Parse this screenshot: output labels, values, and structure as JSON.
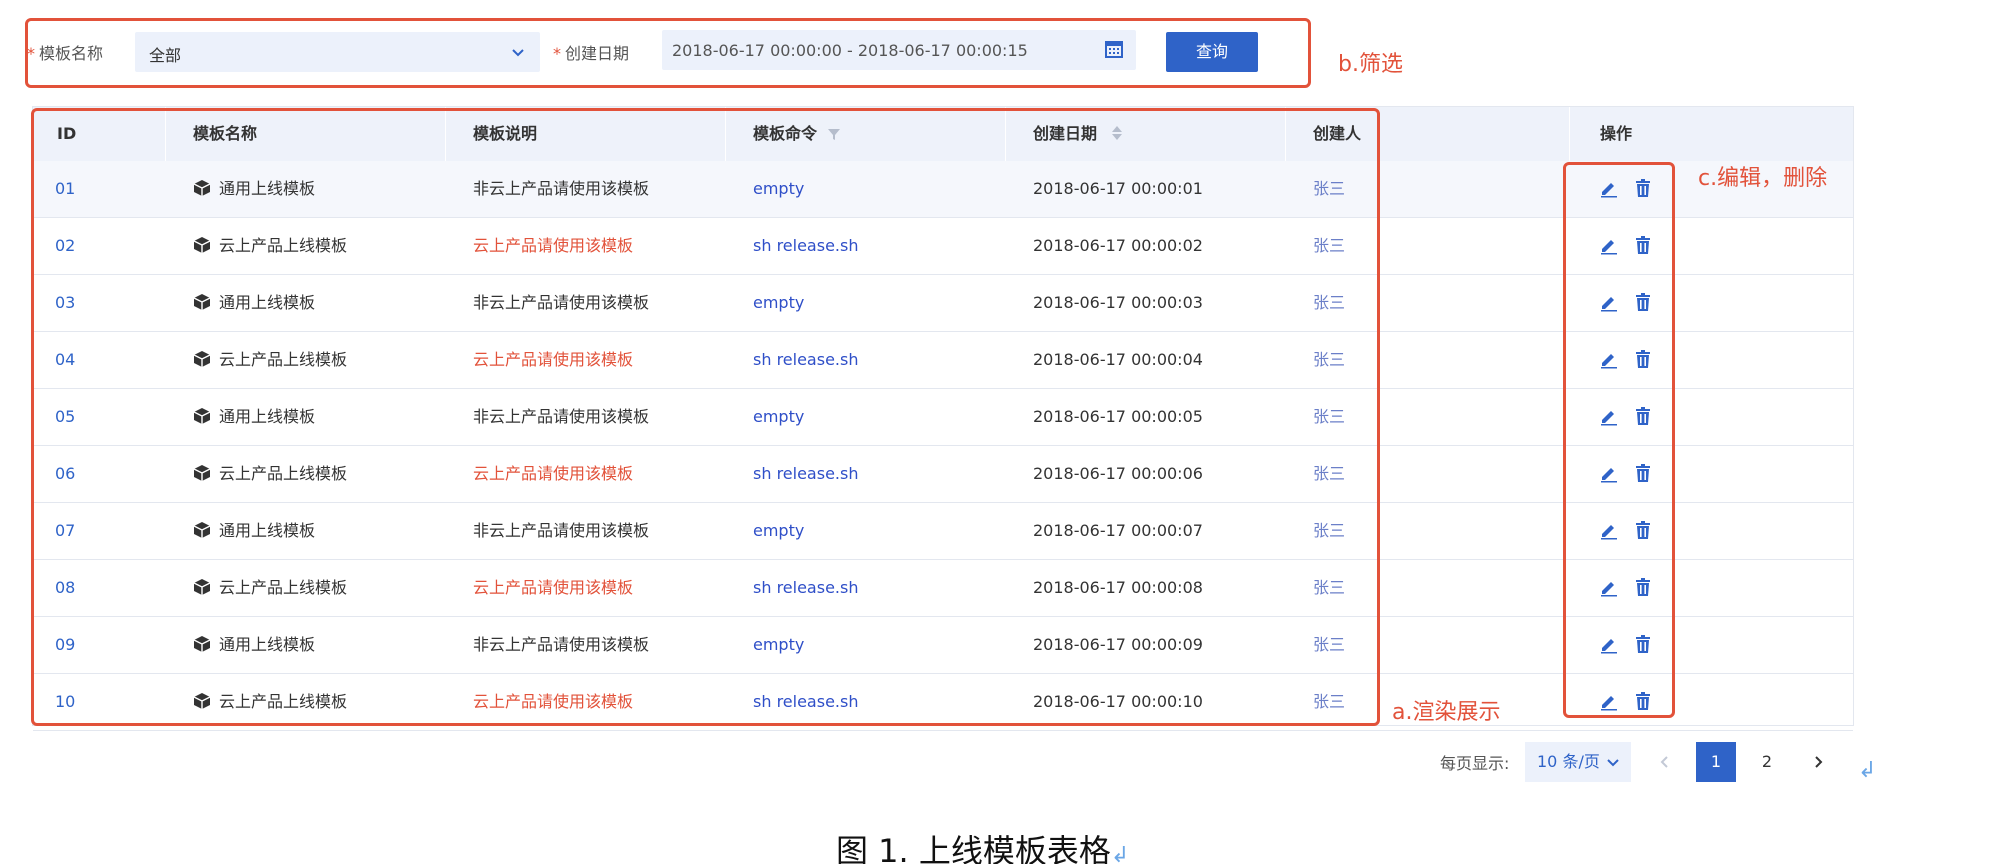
{
  "filter": {
    "template_name_label": "模板名称",
    "template_name_value": "全部",
    "date_label": "创建日期",
    "date_value": "2018-06-17 00:00:00 - 2018-06-17 00:00:15",
    "required_mark": "*",
    "query_button": "查询"
  },
  "table": {
    "headers": {
      "id": "ID",
      "name": "模板名称",
      "desc": "模板说明",
      "cmd": "模板命令",
      "date": "创建日期",
      "creator": "创建人",
      "ops": "操作"
    },
    "rows": [
      {
        "id": "01",
        "name": "通用上线模板",
        "desc": "非云上产品请使用该模板",
        "cmd": "empty",
        "date": "2018-06-17 00:00:01",
        "creator": "张三"
      },
      {
        "id": "02",
        "name": "云上产品上线模板",
        "desc": "云上产品请使用该模板",
        "cmd": "sh release.sh",
        "date": "2018-06-17 00:00:02",
        "creator": "张三"
      },
      {
        "id": "03",
        "name": "通用上线模板",
        "desc": "非云上产品请使用该模板",
        "cmd": "empty",
        "date": "2018-06-17 00:00:03",
        "creator": "张三"
      },
      {
        "id": "04",
        "name": "云上产品上线模板",
        "desc": "云上产品请使用该模板",
        "cmd": "sh release.sh",
        "date": "2018-06-17 00:00:04",
        "creator": "张三"
      },
      {
        "id": "05",
        "name": "通用上线模板",
        "desc": "非云上产品请使用该模板",
        "cmd": "empty",
        "date": "2018-06-17 00:00:05",
        "creator": "张三"
      },
      {
        "id": "06",
        "name": "云上产品上线模板",
        "desc": "云上产品请使用该模板",
        "cmd": "sh release.sh",
        "date": "2018-06-17 00:00:06",
        "creator": "张三"
      },
      {
        "id": "07",
        "name": "通用上线模板",
        "desc": "非云上产品请使用该模板",
        "cmd": "empty",
        "date": "2018-06-17 00:00:07",
        "creator": "张三"
      },
      {
        "id": "08",
        "name": "云上产品上线模板",
        "desc": "云上产品请使用该模板",
        "cmd": "sh release.sh",
        "date": "2018-06-17 00:00:08",
        "creator": "张三"
      },
      {
        "id": "09",
        "name": "通用上线模板",
        "desc": "非云上产品请使用该模板",
        "cmd": "empty",
        "date": "2018-06-17 00:00:09",
        "creator": "张三"
      },
      {
        "id": "10",
        "name": "云上产品上线模板",
        "desc": "云上产品请使用该模板",
        "cmd": "sh release.sh",
        "date": "2018-06-17 00:00:10",
        "creator": "张三"
      }
    ]
  },
  "pagination": {
    "per_page_label": "每页显示:",
    "per_page_value": "10 条/页",
    "pages": [
      "1",
      "2"
    ]
  },
  "annotations": {
    "filter": "b.筛选",
    "ops": "c.编辑，删除",
    "render": "a.渲染展示"
  },
  "caption": "图 1.  上线模板表格",
  "return_mark": "↲",
  "colors": {
    "accent": "#2f63c8",
    "annotation": "#e2523a",
    "warning_text": "#e2523a"
  }
}
